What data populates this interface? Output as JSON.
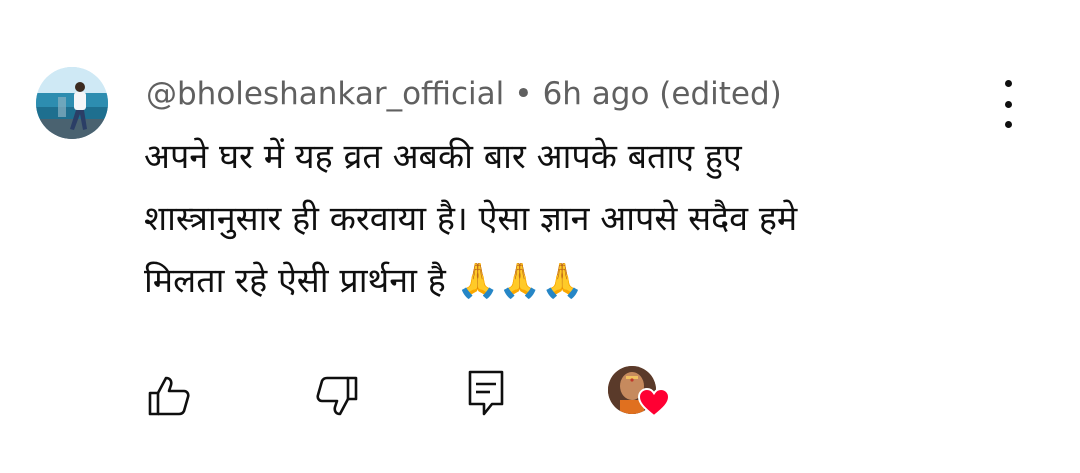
{
  "comment": {
    "author": "@bholeshankar_official",
    "separator": "•",
    "time": "6h ago (edited)",
    "lines": [
      "अपने घर में यह व्रत अबकी बार आपके बताए हुए",
      "शास्त्रानुसार ही करवाया है। ऐसा ज्ञान आपसे सदैव हमे",
      "मिलता रहे ऐसी प्रार्थना है 🙏🙏🙏"
    ]
  },
  "icons": {
    "avatar": "user-avatar",
    "more": "more-vertical-icon",
    "like": "thumbs-up-icon",
    "dislike": "thumbs-down-icon",
    "reply": "reply-comment-icon",
    "creator_heart": "creator-heart-badge"
  },
  "colors": {
    "meta_text": "#606060",
    "body_text": "#0f0f0f",
    "heart": "#ff0033"
  }
}
